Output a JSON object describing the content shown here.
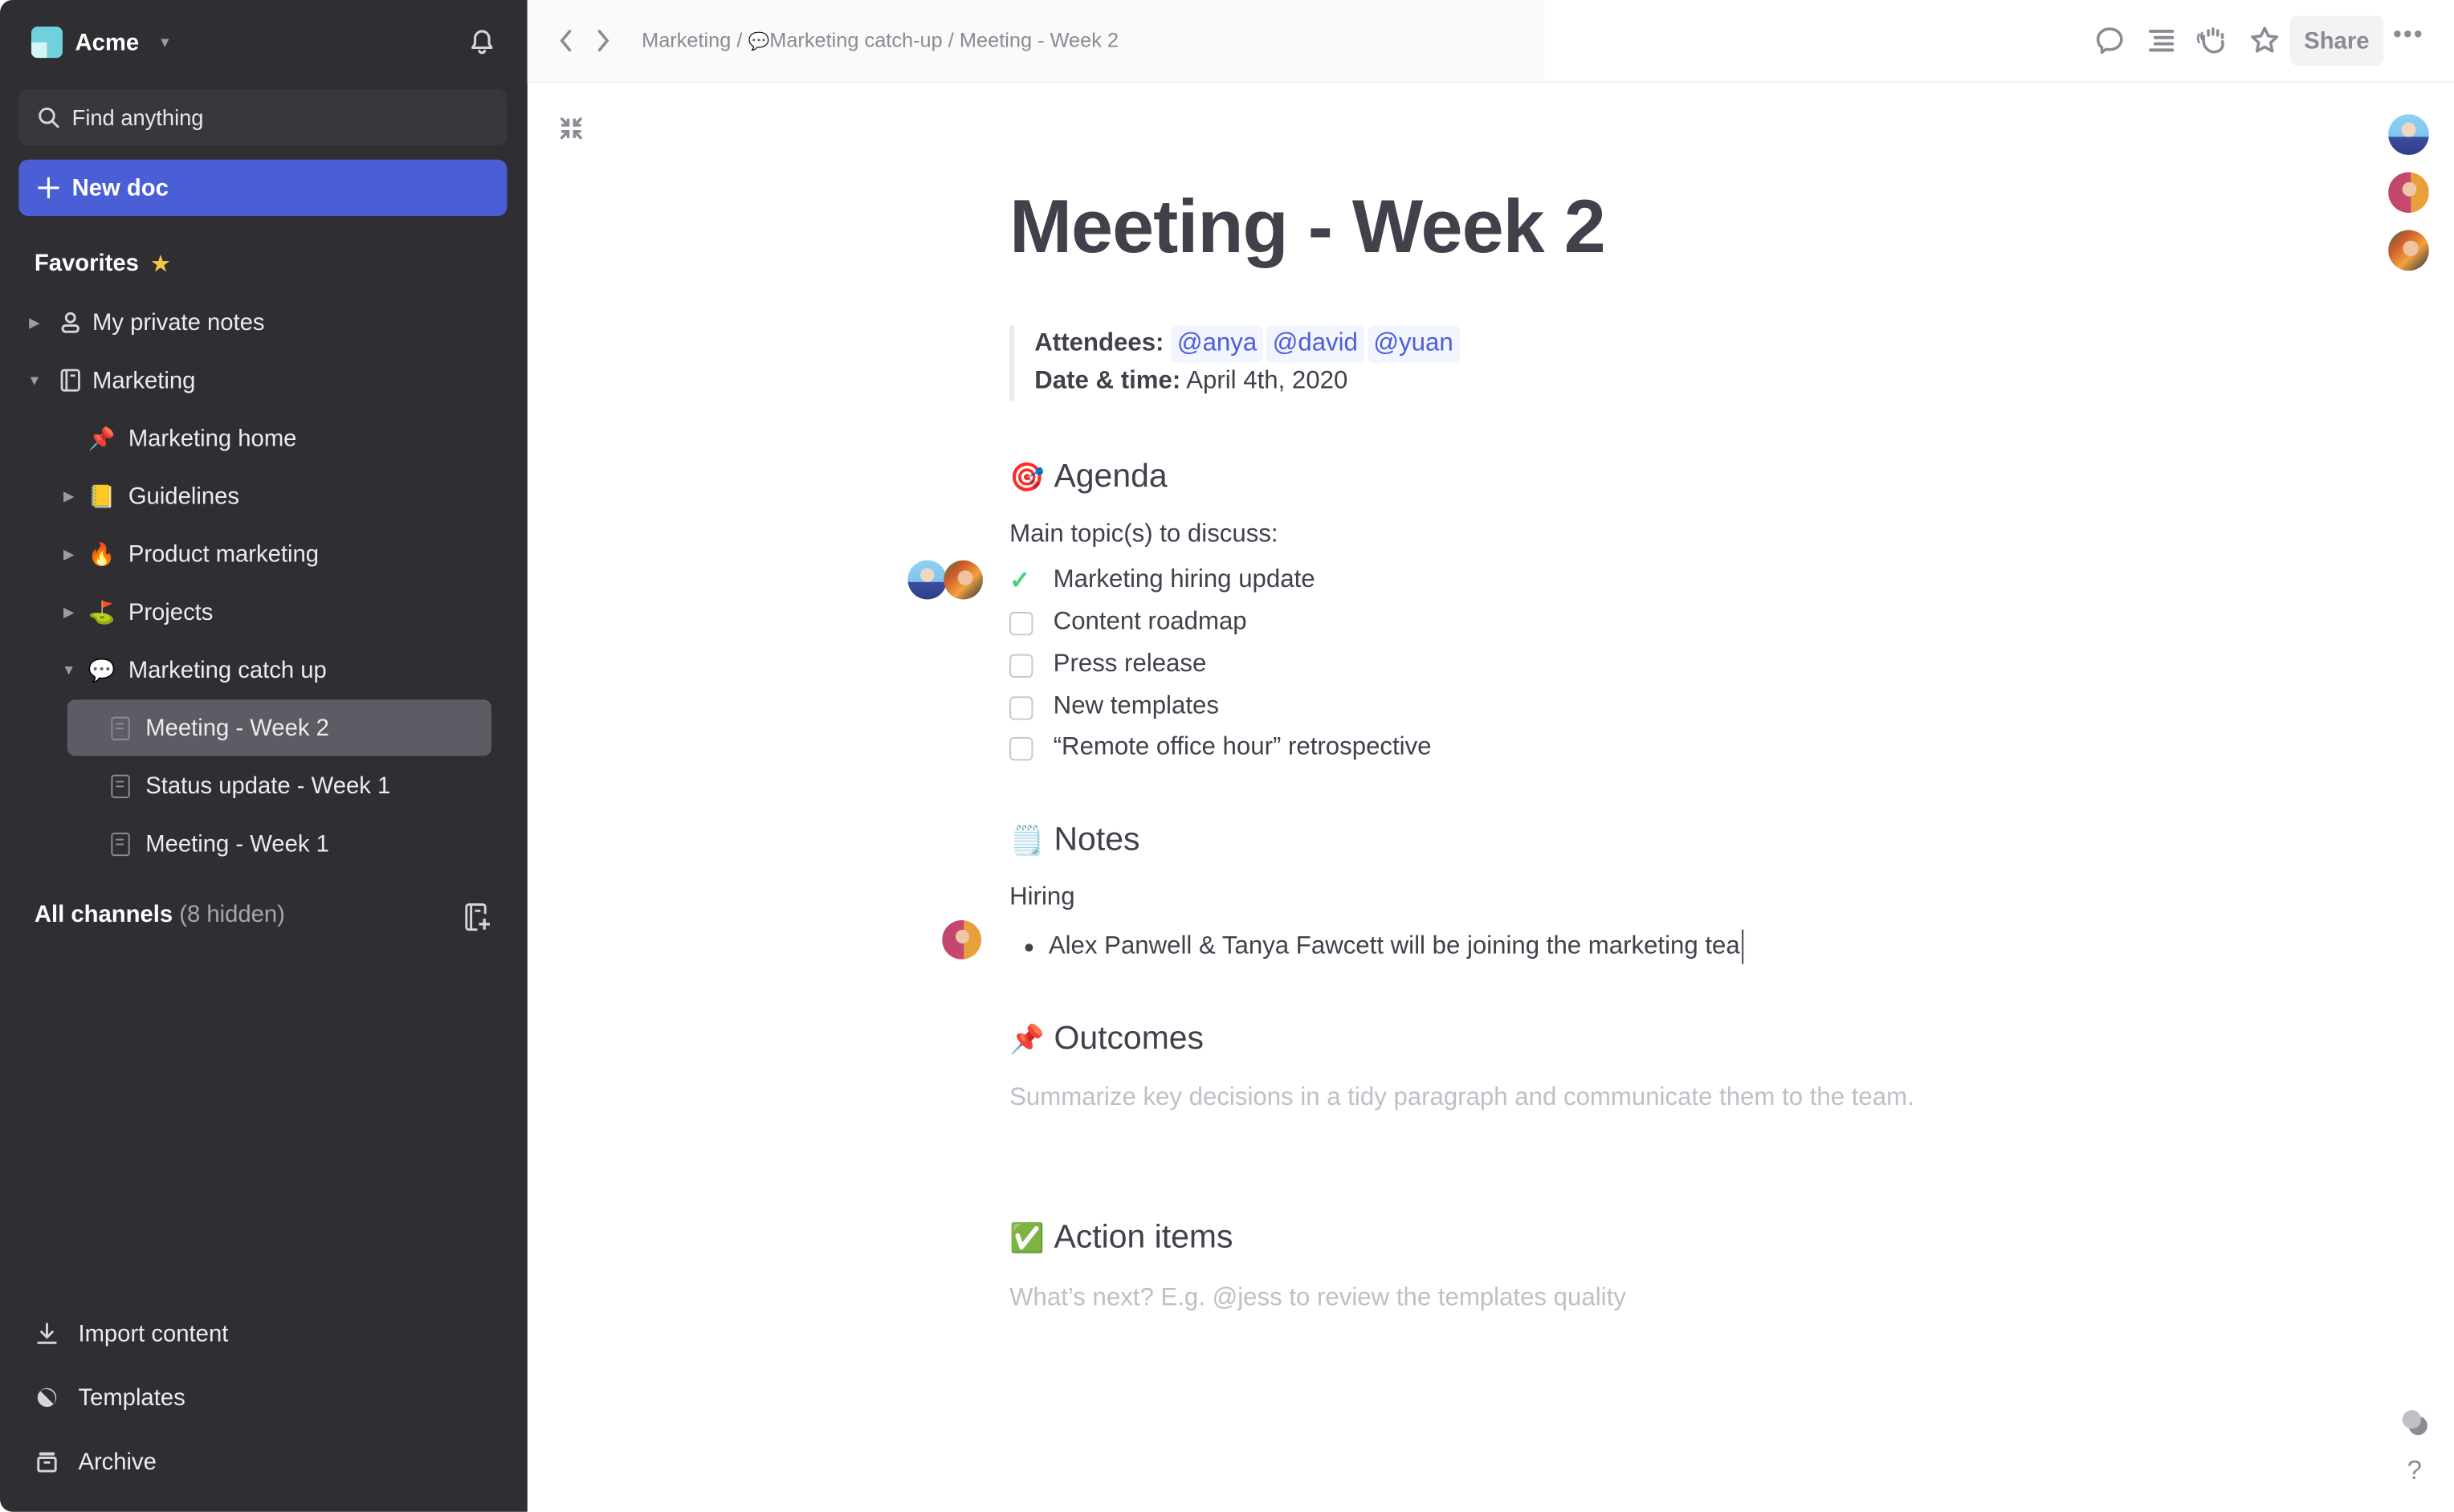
{
  "sidebar": {
    "workspace": "Acme",
    "search_placeholder": "Find anything",
    "new_doc": "New doc",
    "favorites_label": "Favorites",
    "tree": [
      {
        "label": "My private notes",
        "icon": "person-icon",
        "expanded": false
      },
      {
        "label": "Marketing",
        "icon": "notebook-icon",
        "expanded": true
      },
      {
        "label": "Marketing home",
        "emoji": "📌"
      },
      {
        "label": "Guidelines",
        "emoji": "📒",
        "expanded": false
      },
      {
        "label": "Product marketing",
        "emoji": "🔥",
        "expanded": false
      },
      {
        "label": "Projects",
        "emoji": "⛳",
        "expanded": false
      },
      {
        "label": "Marketing catch up",
        "emoji": "💬",
        "expanded": true
      },
      {
        "label": "Meeting - Week 2",
        "icon": "doc-icon",
        "selected": true
      },
      {
        "label": "Status update - Week 1",
        "icon": "doc-icon"
      },
      {
        "label": "Meeting - Week 1",
        "icon": "doc-icon"
      }
    ],
    "channels_label": "All channels",
    "channels_hidden": "(8 hidden)",
    "bottom": [
      {
        "label": "Import content",
        "icon": "download-icon"
      },
      {
        "label": "Templates",
        "icon": "templates-icon"
      },
      {
        "label": "Archive",
        "icon": "archive-icon"
      }
    ]
  },
  "topbar": {
    "breadcrumb": [
      {
        "label": "Marketing"
      },
      {
        "label": "Marketing catch-up",
        "emoji": "💬"
      },
      {
        "label": "Meeting - Week 2"
      }
    ],
    "separator": "/",
    "share_label": "Share",
    "more_label": "•••"
  },
  "doc": {
    "title": "Meeting - Week 2",
    "attendees_label": "Attendees:",
    "attendees": [
      "@anya",
      "@david",
      "@yuan"
    ],
    "date_label": "Date & time:",
    "date_value": "April 4th, 2020",
    "agenda": {
      "emoji": "🎯",
      "heading": "Agenda",
      "intro": "Main topic(s) to discuss:",
      "items": [
        {
          "label": "Marketing hiring update",
          "done": true
        },
        {
          "label": "Content roadmap",
          "done": false
        },
        {
          "label": "Press release",
          "done": false
        },
        {
          "label": "New templates",
          "done": false
        },
        {
          "label": "“Remote office hour” retrospective",
          "done": false
        }
      ]
    },
    "notes": {
      "emoji": "🗒️",
      "heading": "Notes",
      "subheading": "Hiring",
      "bullet": "Alex Panwell & Tanya Fawcett will be joining the marketing tea"
    },
    "outcomes": {
      "emoji": "📌",
      "heading": "Outcomes",
      "placeholder": "Summarize key decisions in a tidy paragraph and communicate them to the team."
    },
    "action_items": {
      "emoji": "✅",
      "heading": "Action items",
      "placeholder": "What’s next? E.g. @jess to review the templates quality"
    }
  },
  "help_label": "?"
}
